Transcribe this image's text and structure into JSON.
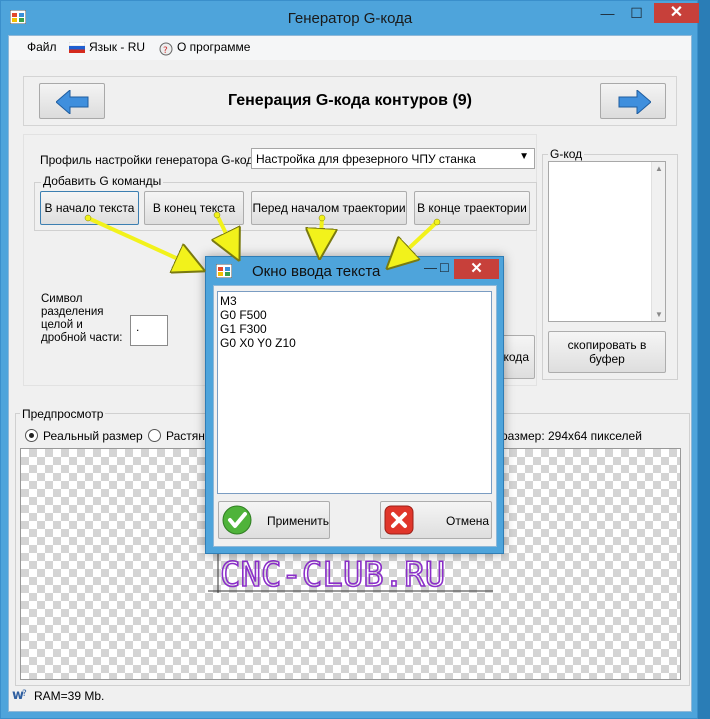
{
  "window": {
    "title": "Генератор G-кода",
    "minimize_glyph": "—",
    "maximize_glyph": "☐",
    "close_glyph": "✕"
  },
  "menu": {
    "file": "Файл",
    "language": "Язык - RU",
    "about": "О программе"
  },
  "nav": {
    "step_title": "Генерация G-кода контуров (9)",
    "back_icon": "arrow-left-icon",
    "forward_icon": "arrow-right-icon"
  },
  "settings": {
    "profile_label": "Профиль настройки генератора G-кода:",
    "profile_value": "Настройка для фрезерного ЧПУ станка",
    "add_commands_group": "Добавить G команды",
    "buttons": [
      "В начало текста",
      "В конец текста",
      "Перед началом траектории",
      "В конце траектории"
    ],
    "separator_label": "Символ\nразделения\nцелой и\nдробной части:",
    "separator_value": ".",
    "generate_button_partial": "кода"
  },
  "gcode_panel": {
    "label": "G-код",
    "copy_button": "скопировать в буфер"
  },
  "preview": {
    "label": "Предпросмотр",
    "radio_real": "Реальный размер",
    "radio_stretch": "Растяну",
    "size_text": "размер: 294x64 пикселей",
    "preview_text": "CNC-CLUB.RU"
  },
  "status": {
    "ram": "RAM=39 Mb."
  },
  "dialog": {
    "title": "Окно ввода текста",
    "text": "M3\nG0 F500\nG1 F300\nG0 X0 Y0 Z10",
    "apply": "Применить",
    "cancel": "Отмена"
  },
  "colors": {
    "title_bar": "#4ea4db",
    "close": "#c7403a",
    "annotation_arrow": "#f2f21b",
    "preview_text": "#8b2fc9"
  }
}
